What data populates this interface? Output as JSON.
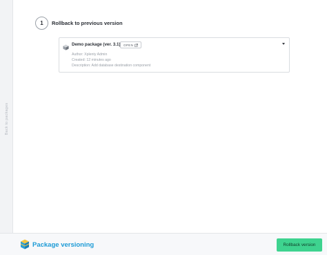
{
  "sidebar": {
    "label": "Back to packages"
  },
  "step": {
    "number": "1",
    "title": "Rollback to previous version"
  },
  "package": {
    "name": "Demo package (ver. 3.1)",
    "open_label": "OPEN",
    "author": "Author: Xplenty Admin",
    "created": "Created: 12 minutes ago",
    "description": "Description: Add database destination component",
    "icon": "package-box-icon"
  },
  "footer": {
    "title": "Package versioning",
    "icon": "package-versioning-icon",
    "rollback_label": "Rollback version"
  },
  "colors": {
    "accent_blue": "#1d9bd6",
    "button_green": "#3ed38f"
  }
}
